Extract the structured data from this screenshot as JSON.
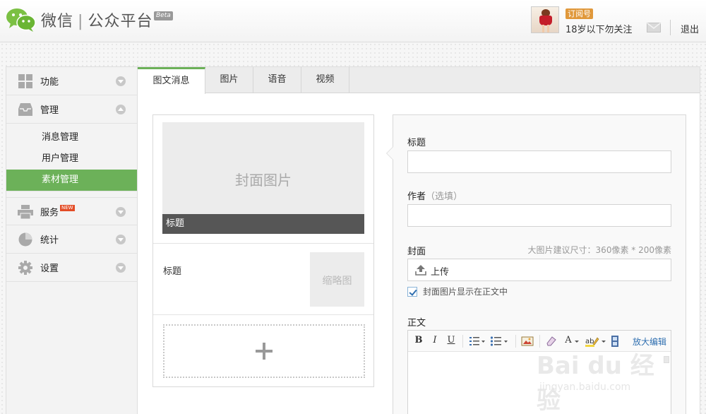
{
  "header": {
    "brand_name": "微信",
    "brand_product": "公众平台",
    "beta_label": "Beta",
    "account_type_badge": "订阅号",
    "username": "18岁以下勿关注",
    "logout_label": "退出"
  },
  "sidebar": {
    "items": [
      {
        "label": "功能",
        "icon": "grid-icon",
        "expanded": false
      },
      {
        "label": "管理",
        "icon": "inbox-icon",
        "expanded": true,
        "children": [
          {
            "label": "消息管理",
            "active": false
          },
          {
            "label": "用户管理",
            "active": false
          },
          {
            "label": "素材管理",
            "active": true
          }
        ]
      },
      {
        "label": "服务",
        "icon": "printer-icon",
        "badge": "NEW",
        "expanded": false
      },
      {
        "label": "统计",
        "icon": "pie-chart-icon",
        "expanded": false
      },
      {
        "label": "设置",
        "icon": "gear-icon",
        "expanded": false
      }
    ]
  },
  "tabs": [
    {
      "label": "图文消息",
      "active": true
    },
    {
      "label": "图片",
      "active": false
    },
    {
      "label": "语音",
      "active": false
    },
    {
      "label": "视频",
      "active": false
    }
  ],
  "article_list": {
    "cover_placeholder": "封面图片",
    "cover_title": "标题",
    "second_item_title": "标题",
    "thumbnail_placeholder": "缩略图"
  },
  "form": {
    "title_label": "标题",
    "author_label": "作者",
    "author_optional": "（选填）",
    "cover_label": "封面",
    "cover_hint": "大图片建议尺寸：360像素 * 200像素",
    "upload_label": "上传",
    "show_cover_checkbox_label": "封面图片显示在正文中",
    "show_cover_checked": true,
    "body_label": "正文",
    "enlarge_editor_label": "放大编辑"
  },
  "editor_toolbar": {
    "bold": "B",
    "italic": "I",
    "underline": "U",
    "font_color": "A"
  },
  "watermark": {
    "main": "Bai du 经验",
    "sub": "jingyan.baidu.com"
  },
  "colors": {
    "accent_green": "#6cb159",
    "badge_orange": "#e0983b",
    "new_red": "#e34c26",
    "link_blue": "#2f6fb0"
  }
}
